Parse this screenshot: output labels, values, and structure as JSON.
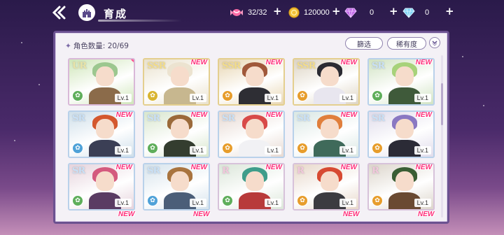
{
  "header": {
    "title": "育成",
    "stamina": "32/32",
    "coins": "120000",
    "gems_a": "0",
    "gems_b": "0"
  },
  "panel": {
    "count_label": "角色数量: 20/69",
    "filter_label": "篩选",
    "rarity_label": "稀有度"
  },
  "cards": [
    {
      "rarity": "UR",
      "new": "",
      "level": "Lv.1",
      "attr_color": "#5fae5b",
      "hair": "#9cc78f",
      "bg": "#cfe6b9",
      "outfit": "#8b6b4a"
    },
    {
      "rarity": "SSR",
      "new": "NEW",
      "level": "Lv.1",
      "attr_color": "#d9b531",
      "hair": "#ece3d0",
      "bg": "#e9e1cc",
      "outfit": "#c7b78f"
    },
    {
      "rarity": "SSR",
      "new": "NEW",
      "level": "Lv.1",
      "attr_color": "#e79d2c",
      "hair": "#a0583a",
      "bg": "#e8d6b2",
      "outfit": "#2e2e34"
    },
    {
      "rarity": "SSR",
      "new": "NEW",
      "level": "Lv.1",
      "attr_color": "#e79d2c",
      "hair": "#2b2b33",
      "bg": "#ddd4c3",
      "outfit": "#e8e6ef"
    },
    {
      "rarity": "SR",
      "new": "NEW",
      "level": "Lv.1",
      "attr_color": "#5fae5b",
      "hair": "#a7d27a",
      "bg": "#d1e3c3",
      "outfit": "#3f5a3a"
    },
    {
      "rarity": "SR",
      "new": "NEW",
      "level": "Lv.1",
      "attr_color": "#4fa2d8",
      "hair": "#d4582e",
      "bg": "#cfdfea",
      "outfit": "#3b3f55"
    },
    {
      "rarity": "SR",
      "new": "NEW",
      "level": "Lv.1",
      "attr_color": "#5fae5b",
      "hair": "#9b6a3a",
      "bg": "#d8e6cd",
      "outfit": "#343d2f"
    },
    {
      "rarity": "SR",
      "new": "NEW",
      "level": "Lv.1",
      "attr_color": "#e79d2c",
      "hair": "#d84a48",
      "bg": "#e7d9d2",
      "outfit": "#f1f1f4"
    },
    {
      "rarity": "SR",
      "new": "NEW",
      "level": "Lv.1",
      "attr_color": "#e79d2c",
      "hair": "#e07f3c",
      "bg": "#d9e7e3",
      "outfit": "#3f6a5a"
    },
    {
      "rarity": "SR",
      "new": "NEW",
      "level": "Lv.1",
      "attr_color": "#e79d2c",
      "hair": "#8a78c2",
      "bg": "#e0dceb",
      "outfit": "#2b2b36"
    },
    {
      "rarity": "SR",
      "new": "NEW",
      "level": "Lv.1",
      "attr_color": "#5fae5b",
      "hair": "#d45a7e",
      "bg": "#e6d3dc",
      "outfit": "#5a3c63"
    },
    {
      "rarity": "SR",
      "new": "NEW",
      "level": "Lv.1",
      "attr_color": "#4fa2d8",
      "hair": "#a9743f",
      "bg": "#d6e3ec",
      "outfit": "#4b5e78"
    },
    {
      "rarity": "R",
      "new": "NEW",
      "level": "Lv.1",
      "attr_color": "#5fae5b",
      "hair": "#3f9d8a",
      "bg": "#dbe6d9",
      "outfit": "#b83a3a"
    },
    {
      "rarity": "R",
      "new": "NEW",
      "level": "Lv.1",
      "attr_color": "#e79d2c",
      "hair": "#d74a32",
      "bg": "#e7d7c9",
      "outfit": "#3b3b40"
    },
    {
      "rarity": "R",
      "new": "NEW",
      "level": "Lv.1",
      "attr_color": "#e79d2c",
      "hair": "#3a5e34",
      "bg": "#dcd5cb",
      "outfit": "#6a4a32"
    }
  ],
  "peek_new": [
    "NEW",
    "NEW",
    "NEW",
    "NEW"
  ]
}
